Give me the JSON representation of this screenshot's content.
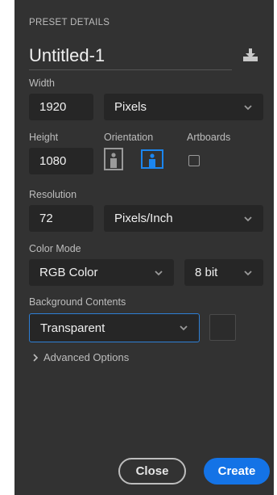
{
  "header": {
    "section_title": "PRESET DETAILS",
    "document_name": "Untitled-1",
    "save_preset_icon": "save-preset-icon"
  },
  "width": {
    "label": "Width",
    "value": "1920",
    "unit": "Pixels"
  },
  "height": {
    "label": "Height",
    "value": "1080"
  },
  "orientation": {
    "label": "Orientation",
    "selected": "landscape"
  },
  "artboards": {
    "label": "Artboards",
    "checked": false
  },
  "resolution": {
    "label": "Resolution",
    "value": "72",
    "unit": "Pixels/Inch"
  },
  "color_mode": {
    "label": "Color Mode",
    "mode": "RGB Color",
    "depth": "8 bit"
  },
  "background": {
    "label": "Background Contents",
    "value": "Transparent"
  },
  "advanced": {
    "label": "Advanced Options"
  },
  "actions": {
    "close_label": "Close",
    "create_label": "Create"
  },
  "colors": {
    "panel_bg": "#323232",
    "field_bg": "#262626",
    "accent": "#1473e6",
    "focus_border": "#2d7fd6"
  }
}
